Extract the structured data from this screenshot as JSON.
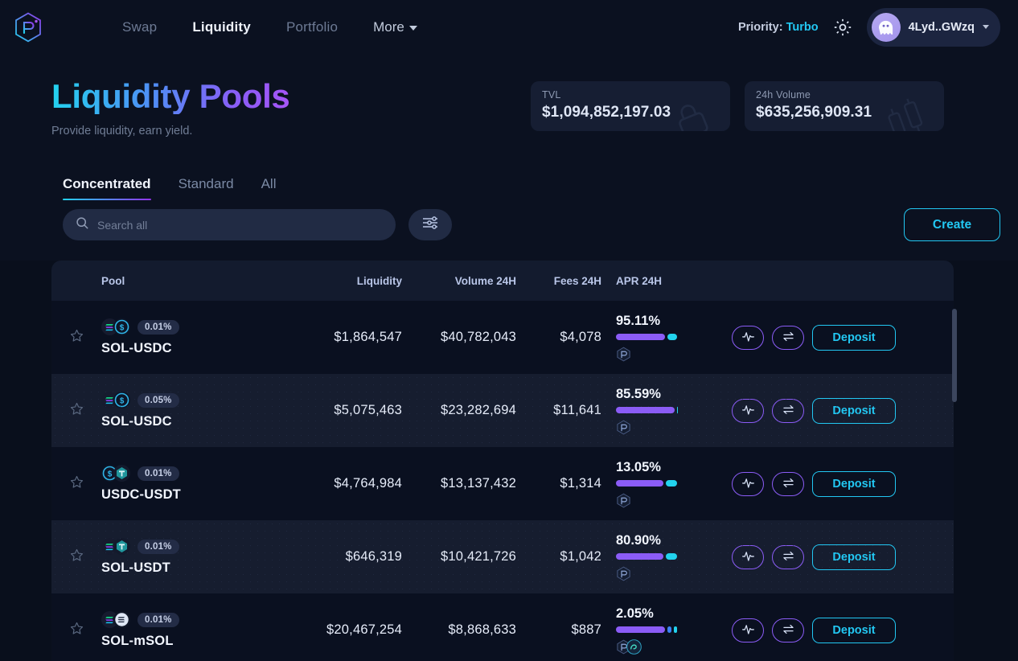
{
  "brand": {
    "logo_icon": "raydium-hexagon-logo"
  },
  "nav": {
    "links": [
      {
        "label": "Swap",
        "active": false
      },
      {
        "label": "Liquidity",
        "active": true
      },
      {
        "label": "Portfolio",
        "active": false
      }
    ],
    "more_label": "More",
    "more_chevron_icon": "chevron-down-icon"
  },
  "header_right": {
    "priority_prefix": "Priority:",
    "priority_value": "Turbo",
    "settings_icon": "gear-icon",
    "wallet_avatar_icon": "phantom-ghost-icon",
    "wallet_address": "4Lyd..GWzq",
    "wallet_chevron_icon": "chevron-down-icon"
  },
  "hero": {
    "title": "Liquidity Pools",
    "subtitle": "Provide liquidity, earn yield.",
    "stats": [
      {
        "label": "TVL",
        "value": "$1,094,852,197.03",
        "icon": "lock-icon"
      },
      {
        "label": "24h Volume",
        "value": "$635,256,909.31",
        "icon": "candlestick-icon"
      }
    ]
  },
  "tabs": [
    {
      "label": "Concentrated",
      "active": true
    },
    {
      "label": "Standard",
      "active": false
    },
    {
      "label": "All",
      "active": false
    }
  ],
  "toolbar": {
    "search_placeholder": "Search all",
    "search_value": "",
    "search_icon": "search-icon",
    "filter_icon": "sliders-filter-icon",
    "create_label": "Create"
  },
  "table": {
    "columns": {
      "pool": "Pool",
      "liquidity": "Liquidity",
      "volume": "Volume 24H",
      "fees": "Fees 24H",
      "apr": "APR 24H"
    },
    "row_actions": {
      "chart_icon": "pulse-chart-icon",
      "swap_icon": "swap-arrows-icon",
      "deposit_label": "Deposit"
    },
    "star_icon": "star-outline-icon",
    "rows": [
      {
        "favorite": false,
        "tokens": [
          "SOL",
          "USDC"
        ],
        "fee_tier": "0.01%",
        "pool_name": "SOL-USDC",
        "liquidity": "$1,864,547",
        "volume_24h": "$40,782,043",
        "fees_24h": "$4,078",
        "apr_24h": "95.11%",
        "apr_segments": [
          {
            "color": "#8b5cf6",
            "pct": 78
          },
          {
            "color": "#22d3ee",
            "pct": 15
          }
        ],
        "rewards": [
          "RAY"
        ]
      },
      {
        "favorite": false,
        "tokens": [
          "SOL",
          "USDC"
        ],
        "fee_tier": "0.05%",
        "pool_name": "SOL-USDC",
        "liquidity": "$5,075,463",
        "volume_24h": "$23,282,694",
        "fees_24h": "$11,641",
        "apr_24h": "85.59%",
        "apr_segments": [
          {
            "color": "#8b5cf6",
            "pct": 93
          },
          {
            "color": "#22d3ee",
            "pct": 2
          }
        ],
        "rewards": [
          "RAY"
        ]
      },
      {
        "favorite": false,
        "tokens": [
          "USDC",
          "USDT"
        ],
        "fee_tier": "0.01%",
        "pool_name": "USDC-USDT",
        "liquidity": "$4,764,984",
        "volume_24h": "$13,137,432",
        "fees_24h": "$1,314",
        "apr_24h": "13.05%",
        "apr_segments": [
          {
            "color": "#8b5cf6",
            "pct": 76
          },
          {
            "color": "#22d3ee",
            "pct": 17
          }
        ],
        "rewards": [
          "RAY"
        ]
      },
      {
        "favorite": false,
        "tokens": [
          "SOL",
          "USDT"
        ],
        "fee_tier": "0.01%",
        "pool_name": "SOL-USDT",
        "liquidity": "$646,319",
        "volume_24h": "$10,421,726",
        "fees_24h": "$1,042",
        "apr_24h": "80.90%",
        "apr_segments": [
          {
            "color": "#8b5cf6",
            "pct": 75
          },
          {
            "color": "#22d3ee",
            "pct": 18
          }
        ],
        "rewards": [
          "RAY"
        ]
      },
      {
        "favorite": false,
        "tokens": [
          "SOL",
          "mSOL"
        ],
        "fee_tier": "0.01%",
        "pool_name": "SOL-mSOL",
        "liquidity": "$20,467,254",
        "volume_24h": "$8,868,633",
        "fees_24h": "$887",
        "apr_24h": "2.05%",
        "apr_segments": [
          {
            "color": "#8b5cf6",
            "pct": 78
          },
          {
            "color": "#3b82f6",
            "pct": 6
          },
          {
            "color": "#22d3ee",
            "pct": 6
          }
        ],
        "rewards": [
          "RAY",
          "MNDE"
        ]
      }
    ]
  },
  "colors": {
    "accent_cyan": "#22c7f2",
    "accent_purple": "#8b5cf6",
    "page_bg": "#090f1c",
    "panel_bg": "#0b1120",
    "row_even": "#161d2f",
    "row_odd": "#0a1020"
  }
}
